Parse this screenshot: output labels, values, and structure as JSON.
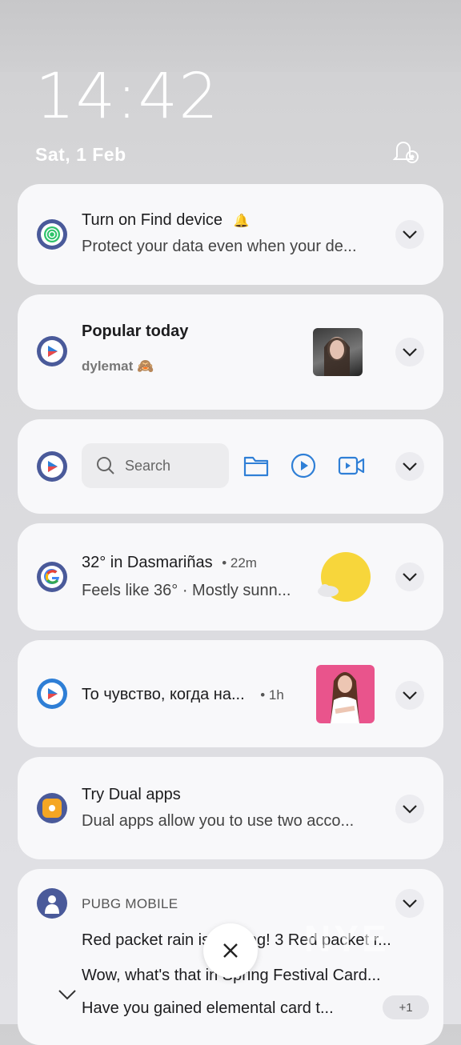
{
  "lockscreen": {
    "time": "14:42",
    "date": "Sat, 1 Feb"
  },
  "notifications": [
    {
      "title": "Turn on Find device",
      "text": "Protect your data even when your de..."
    },
    {
      "title": "Popular today",
      "text": "dylemat 🙈"
    },
    {
      "search_placeholder": "Search"
    },
    {
      "title": "32° in Dasmariñas",
      "time": "• 22m",
      "text": "Feels like 36° · Mostly sunn..."
    },
    {
      "title": "То чувство, когда на...",
      "time": "• 1h"
    },
    {
      "title": "Try Dual apps",
      "text": "Dual apps allow you to use two acco..."
    },
    {
      "app": "PUBG MOBILE",
      "lines": [
        "Red packet rain is coming! 3 Red packet r...",
        "Wow, what's that in Spring Festival Card...",
        "Have you gained elemental card t..."
      ],
      "more": "+1"
    }
  ],
  "colors": {
    "accent": "#2f7fd6",
    "card": "#f8f8fa",
    "weather_sun": "#f7d63b"
  },
  "watermark": "NYE"
}
